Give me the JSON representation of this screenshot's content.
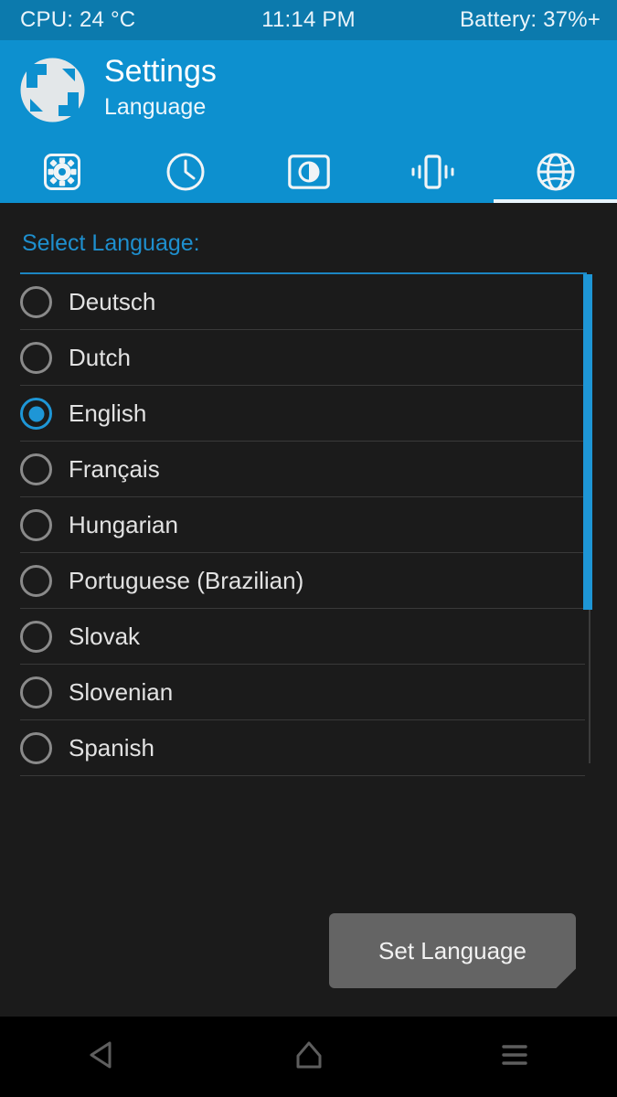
{
  "statusbar": {
    "cpu": "CPU: 24 °C",
    "clock": "11:14 PM",
    "battery": "Battery: 37%+"
  },
  "header": {
    "title": "Settings",
    "subtitle": "Language",
    "logo_icon": "twrp-logo-icon",
    "background_color": "#0d90cf"
  },
  "tabs": [
    {
      "name": "general",
      "icon": "gear-icon",
      "active": false
    },
    {
      "name": "time",
      "icon": "clock-icon",
      "active": false
    },
    {
      "name": "brightness",
      "icon": "brightness-icon",
      "active": false
    },
    {
      "name": "vibration",
      "icon": "vibration-icon",
      "active": false
    },
    {
      "name": "language",
      "icon": "globe-icon",
      "active": true
    }
  ],
  "content": {
    "section_label": "Select Language:",
    "accent_color": "#1e96d6",
    "languages": [
      {
        "label": "Deutsch",
        "selected": false
      },
      {
        "label": "Dutch",
        "selected": false
      },
      {
        "label": "English",
        "selected": true
      },
      {
        "label": "Français",
        "selected": false
      },
      {
        "label": "Hungarian",
        "selected": false
      },
      {
        "label": "Portuguese (Brazilian)",
        "selected": false
      },
      {
        "label": "Slovak",
        "selected": false
      },
      {
        "label": "Slovenian",
        "selected": false
      },
      {
        "label": "Spanish",
        "selected": false
      }
    ],
    "set_language_label": "Set Language"
  },
  "navbar": {
    "back_icon": "back-triangle-icon",
    "home_icon": "home-pentagon-icon",
    "menu_icon": "menu-hamburger-icon"
  }
}
